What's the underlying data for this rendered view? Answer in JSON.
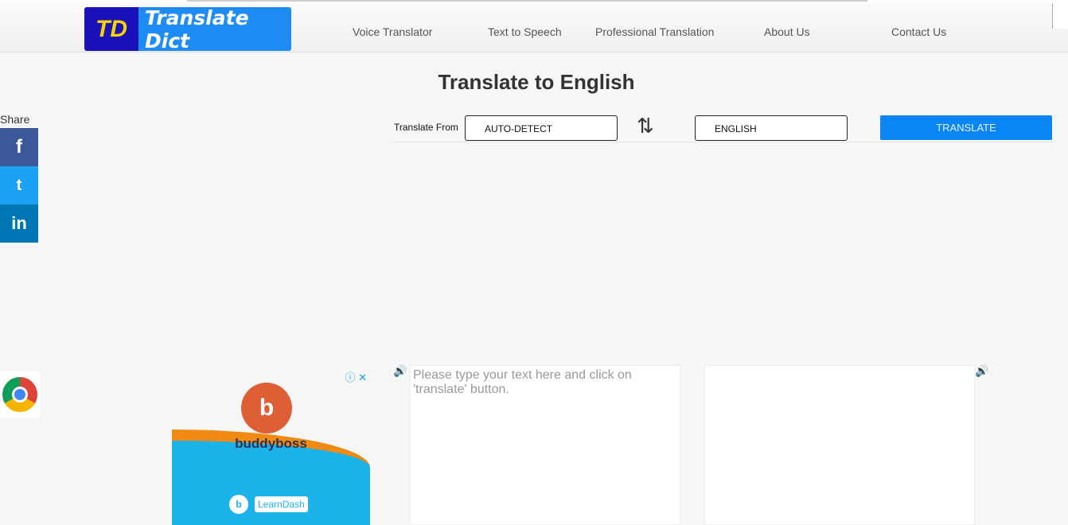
{
  "header": {
    "logo_mark": "TD",
    "logo_text": "Translate Dict",
    "nav": [
      "Voice Translator",
      "Text to Speech",
      "Professional Translation",
      "About Us",
      "Contact Us"
    ]
  },
  "page_title": "Translate to English",
  "share": {
    "label": "Share",
    "facebook": "f",
    "twitter": "t",
    "linkedin": "in",
    "colors": {
      "facebook": "#3b5998",
      "twitter": "#1da1f2",
      "linkedin": "#0077b5"
    }
  },
  "translator": {
    "from_label": "Translate From",
    "from_value": "AUTO-DETECT",
    "to_value": "ENGLISH",
    "translate_label": "TRANSLATE",
    "swap_icon": "⇅",
    "input_placeholder": "Please type your text here and click on 'translate' button.",
    "speaker_icon": "🔊"
  },
  "ad": {
    "brand": "buddyboss",
    "brand_mark": "b",
    "partner_mark": "b",
    "partner": "LearnDash",
    "info_icon": "ⓘ ✕"
  }
}
